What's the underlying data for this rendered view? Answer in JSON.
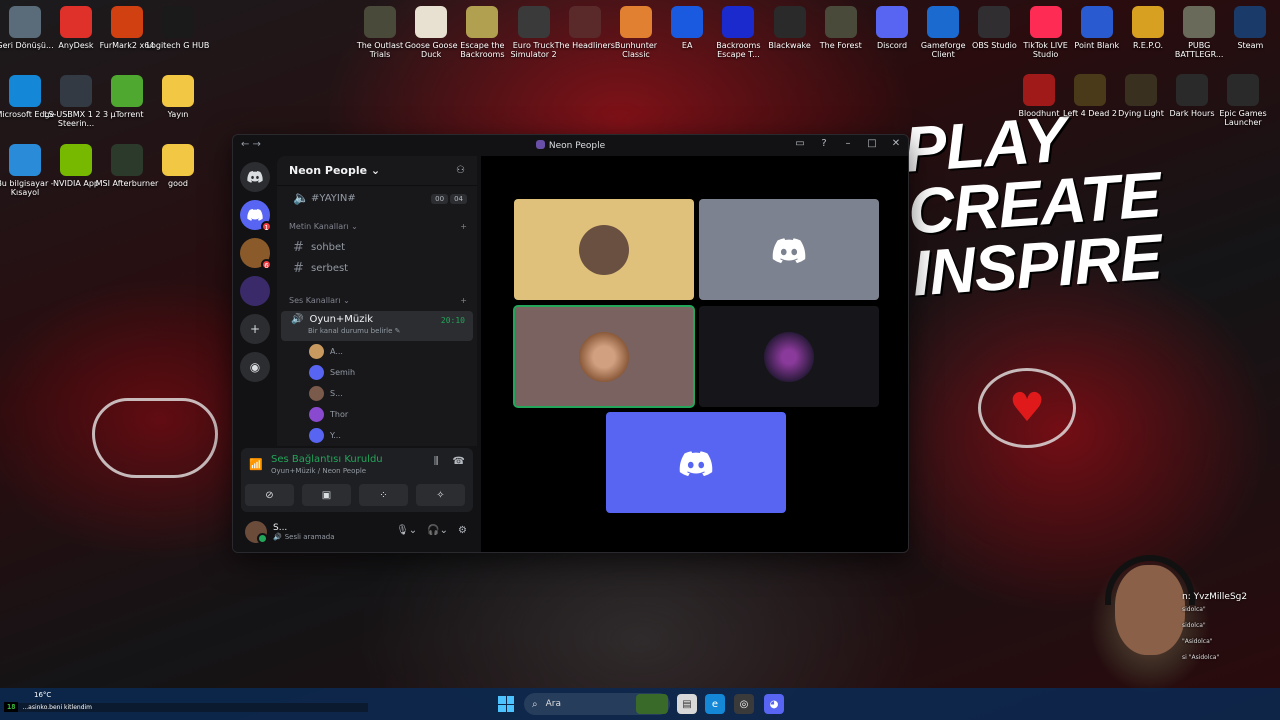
{
  "desktop": {
    "left_icons": [
      {
        "label": "Geri Dönüşü...",
        "icon": "recycle-bin-icon",
        "color": "#5a6b7a"
      },
      {
        "label": "AnyDesk",
        "icon": "anydesk-icon",
        "color": "#e0302a"
      },
      {
        "label": "FurMark2 x64",
        "icon": "furmark-icon",
        "color": "#d04010"
      },
      {
        "label": "Logitech G HUB",
        "icon": "logitech-icon",
        "color": "#1a1a1a"
      },
      {
        "label": "Microsoft Edge",
        "icon": "edge-icon",
        "color": "#1488d6"
      },
      {
        "label": "LS-USBMX 1 2 3 Steerin...",
        "icon": "steering-icon",
        "color": "#333a44"
      },
      {
        "label": "µTorrent",
        "icon": "utorrent-icon",
        "color": "#4fa830"
      },
      {
        "label": "Yayın",
        "icon": "folder-icon",
        "color": "#f2c744"
      },
      {
        "label": "Bu bilgisayar - Kısayol",
        "icon": "computer-icon",
        "color": "#2a8cd8"
      },
      {
        "label": "NVIDIA App",
        "icon": "nvidia-icon",
        "color": "#76b900"
      },
      {
        "label": "MSI Afterburner",
        "icon": "msi-icon",
        "color": "#2b3a2b"
      },
      {
        "label": "good",
        "icon": "folder-icon",
        "color": "#f2c744"
      }
    ],
    "top_icons": [
      {
        "label": "The Outlast Trials",
        "icon": "outlast-icon",
        "color": "#4a4a3a"
      },
      {
        "label": "Goose Goose Duck",
        "icon": "goose-icon",
        "color": "#e8e0d0"
      },
      {
        "label": "Escape the Backrooms",
        "icon": "backrooms-icon",
        "color": "#b0a050"
      },
      {
        "label": "Euro Truck Simulator 2",
        "icon": "truck-icon",
        "color": "#3a3a3a"
      },
      {
        "label": "The Headliners",
        "icon": "headliners-icon",
        "color": "#5a2a2a"
      },
      {
        "label": "Bunhunter Classic",
        "icon": "bunhunter-icon",
        "color": "#e08030"
      },
      {
        "label": "EA",
        "icon": "ea-icon",
        "color": "#1a5ae0"
      },
      {
        "label": "Backrooms Escape T...",
        "icon": "bet-icon",
        "color": "#1a2acc"
      },
      {
        "label": "Blackwake",
        "icon": "blackwake-icon",
        "color": "#2a2a2a"
      },
      {
        "label": "The Forest",
        "icon": "forest-icon",
        "color": "#4a4a3a"
      },
      {
        "label": "Discord",
        "icon": "discord-icon",
        "color": "#5865f2"
      },
      {
        "label": "Gameforge Client",
        "icon": "gameforge-icon",
        "color": "#1a6ad0"
      },
      {
        "label": "OBS Studio",
        "icon": "obs-icon",
        "color": "#302e31"
      },
      {
        "label": "TikTok LIVE Studio",
        "icon": "tiktok-icon",
        "color": "#fe2c55"
      },
      {
        "label": "Point Blank",
        "icon": "pointblank-icon",
        "color": "#2a5ad0"
      },
      {
        "label": "R.E.P.O.",
        "icon": "repo-icon",
        "color": "#d8a020"
      },
      {
        "label": "PUBG BATTLEGR...",
        "icon": "pubg-icon",
        "color": "#6a6a5a"
      },
      {
        "label": "Steam",
        "icon": "steam-icon",
        "color": "#1a3a6a"
      }
    ],
    "right_icons": [
      {
        "label": "Bloodhunt",
        "icon": "bloodhunt-icon",
        "color": "#a01a1a"
      },
      {
        "label": "Left 4 Dead 2",
        "icon": "l4d2-icon",
        "color": "#4a3a1a"
      },
      {
        "label": "Dying Light",
        "icon": "dyinglight-icon",
        "color": "#3a3020"
      },
      {
        "label": "Dark Hours",
        "icon": "darkhours-icon",
        "color": "#2a2a2a"
      },
      {
        "label": "Epic Games Launcher",
        "icon": "epic-icon",
        "color": "#2a2a2a"
      }
    ],
    "wallpaper_text": [
      "PLAY",
      "CREATE",
      "INSPIRE"
    ]
  },
  "window": {
    "title": "Neon People",
    "server_name": "Neon People",
    "pinned_channel": {
      "name": "#YAYIN#",
      "count_a": "00",
      "count_b": "04"
    },
    "text_category": "Metin Kanalları",
    "text_channels": [
      "sohbet",
      "serbest"
    ],
    "voice_category": "Ses Kanalları",
    "voice_channel": {
      "name": "Oyun+Müzik",
      "timer": "20:10",
      "status": "Bir kanal durumu belirle"
    },
    "voice_users": [
      {
        "name": "A...",
        "color": "#c89a60"
      },
      {
        "name": "Semih",
        "color": "#5865f2"
      },
      {
        "name": "S...",
        "color": "#7a5a4a"
      },
      {
        "name": "Thor",
        "color": "#8a4ad0"
      },
      {
        "name": "Y...",
        "color": "#5865f2"
      }
    ],
    "guild_badges": [
      "1",
      "6"
    ],
    "connection": {
      "title": "Ses Bağlantısı Kuruldu",
      "subtitle": "Oyun+Müzik / Neon People"
    },
    "user": {
      "name": "S...",
      "status": "Sesli aramada"
    },
    "tiles_colors": {
      "t1": "#dfc17b",
      "t2": "#7d8290",
      "t3": "#7a6260",
      "t4": "#16161a",
      "t5": "#5865f2"
    }
  },
  "webcam_chat": {
    "header": "n: YvzMilleSg2",
    "lines": [
      "sidolca\"",
      "sidolca\"",
      "\"Asidolca\"",
      "si \"Asidolca\"",
      "\"sidolca\""
    ]
  },
  "taskbar": {
    "temperature": "16°C",
    "terminal_tag": "18",
    "terminal_text": "...asinko.beni kitlendim",
    "search_placeholder": "Ara"
  }
}
